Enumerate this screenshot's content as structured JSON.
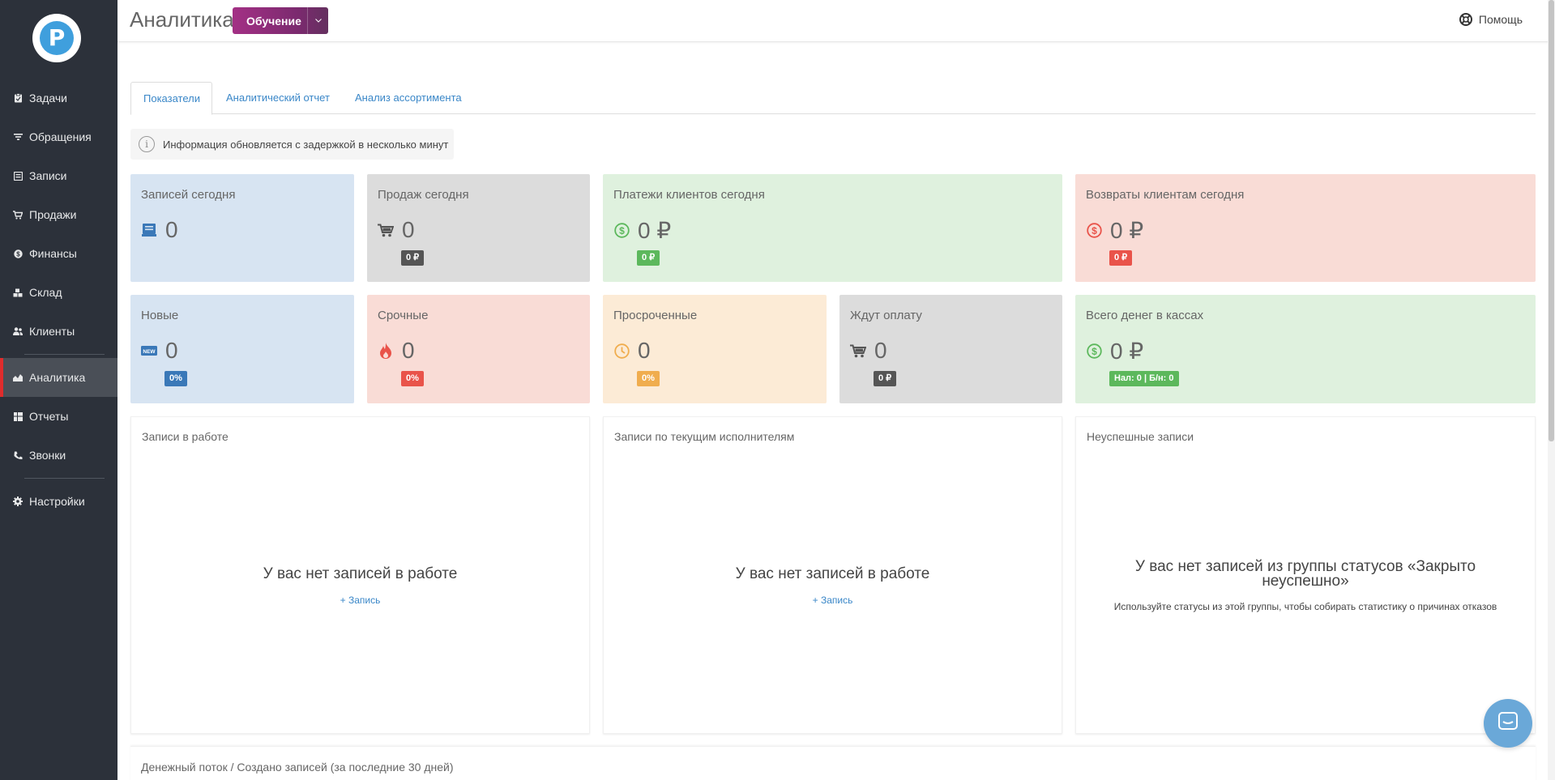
{
  "sidebar": {
    "logo_letter": "P",
    "items": [
      {
        "label": "Задачи",
        "icon": "clipboard-icon"
      },
      {
        "label": "Обращения",
        "icon": "filter-icon"
      },
      {
        "label": "Записи",
        "icon": "records-icon"
      },
      {
        "label": "Продажи",
        "icon": "cart-icon"
      },
      {
        "label": "Финансы",
        "icon": "coin-icon"
      },
      {
        "label": "Склад",
        "icon": "boxes-icon"
      },
      {
        "label": "Клиенты",
        "icon": "users-icon"
      },
      {
        "label": "Аналитика",
        "icon": "chart-area-icon",
        "active": true
      },
      {
        "label": "Отчеты",
        "icon": "table-icon"
      },
      {
        "label": "Звонки",
        "icon": "phone-icon"
      },
      {
        "label": "Настройки",
        "icon": "gear-icon"
      }
    ]
  },
  "header": {
    "title": "Аналитика",
    "learn_label": "Обучение",
    "help_label": "Помощь"
  },
  "tabs": [
    {
      "label": "Показатели",
      "active": true
    },
    {
      "label": "Аналитический отчет"
    },
    {
      "label": "Анализ ассортимента"
    }
  ],
  "info_text": "Информация обновляется с задержкой в несколько минут",
  "cards": {
    "records_today": {
      "title": "Записей сегодня",
      "value": "0"
    },
    "sales_today": {
      "title": "Продаж сегодня",
      "value": "0",
      "badge": "0 ₽"
    },
    "payments_today": {
      "title": "Платежи клиентов сегодня",
      "value": "0 ₽",
      "badge": "0 ₽"
    },
    "refunds_today": {
      "title": "Возвраты клиентам сегодня",
      "value": "0 ₽",
      "badge": "0 ₽"
    },
    "new": {
      "title": "Новые",
      "value": "0",
      "badge": "0%"
    },
    "urgent": {
      "title": "Срочные",
      "value": "0",
      "badge": "0%"
    },
    "overdue": {
      "title": "Просроченные",
      "value": "0",
      "badge": "0%"
    },
    "awaiting_payment": {
      "title": "Ждут оплату",
      "value": "0",
      "badge": "0 ₽"
    },
    "total_cash": {
      "title": "Всего денег в кассах",
      "value": "0 ₽",
      "badge": "Нал: 0 | Б/н: 0"
    }
  },
  "panels": {
    "in_work": {
      "title": "Записи в работе",
      "empty": "У вас нет записей в работе",
      "link": "+ Запись"
    },
    "by_executor": {
      "title": "Записи по текущим исполнителям",
      "empty": "У вас нет записей в работе",
      "link": "+ Запись"
    },
    "failed": {
      "title": "Неуспешные записи",
      "empty_line1": "У вас нет записей из группы статусов «Закрыто",
      "empty_line2": "неуспешно»",
      "note": "Используйте статусы из этой группы, чтобы собирать статистику о причинах отказов"
    }
  },
  "cashflow_title": "Денежный поток / Создано записей (за последние 30 дней)",
  "colors": {
    "sidebar_bg": "#2c313a",
    "active_marker": "#e02c2c",
    "link": "#3a87c8",
    "badge_gray": "#555555",
    "badge_green": "#5cb85c",
    "badge_red": "#e9534a",
    "badge_blue": "#3a78b8",
    "badge_orange": "#f0ad4e"
  }
}
